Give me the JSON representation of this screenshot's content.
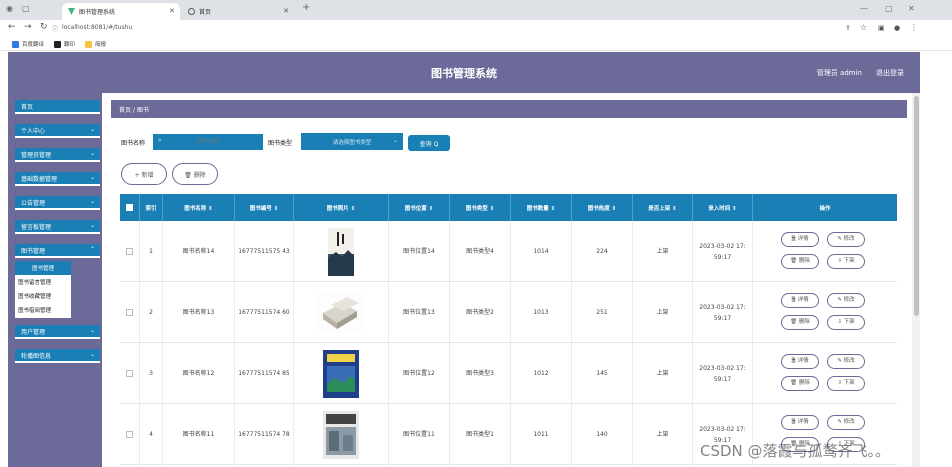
{
  "browser": {
    "tabs": [
      {
        "label": "图书管理系统",
        "active": true
      },
      {
        "label": "首页",
        "active": false
      }
    ],
    "new_tab": "+",
    "url": "localhost:8081/#/tushu",
    "bookmarks": [
      "百度翻译",
      "翻印",
      "简报"
    ],
    "win_min": "—",
    "win_max": "▢",
    "win_close": "✕"
  },
  "header": {
    "title": "图书管理系统",
    "user": "管理员 admin",
    "logout": "退出登录"
  },
  "sidebar": {
    "items": [
      {
        "label": "首页",
        "chevron": ""
      },
      {
        "label": "个人中心",
        "chevron": "⌄"
      },
      {
        "label": "管理员管理",
        "chevron": "⌄"
      },
      {
        "label": "基础数据管理",
        "chevron": "⌄"
      },
      {
        "label": "公告管理",
        "chevron": "⌄"
      },
      {
        "label": "留言板管理",
        "chevron": "⌄"
      },
      {
        "label": "图书管理",
        "chevron": "⌃"
      },
      {
        "label": "用户管理",
        "chevron": "⌄"
      },
      {
        "label": "轮播图信息",
        "chevron": "⌄"
      }
    ],
    "submenu": [
      "图书管理",
      "图书留言管理",
      "图书收藏管理",
      "图书借阅管理"
    ]
  },
  "breadcrumb": "首页 / 图书",
  "filters": {
    "name_label": "图书名称",
    "name_placeholder": "图书名称",
    "type_label": "图书类型",
    "type_placeholder": "请选择图书类型",
    "search_button": "查询 Q"
  },
  "actions": {
    "add": "+ 新增",
    "delete": "🗑 删除"
  },
  "table": {
    "headers": [
      "",
      "索引",
      "图书名称 ⇕",
      "图书编号 ⇕",
      "图书照片 ⇕",
      "图书位置 ⇕",
      "图书类型 ⇕",
      "图书数量 ⇕",
      "图书热度 ⇕",
      "是否上架 ⇕",
      "录入时间 ⇕",
      "操作"
    ],
    "row_buttons": [
      "🗎 详情",
      "✎ 修改",
      "🗑 删除",
      "⇩ 下架"
    ],
    "rows": [
      {
        "index": "1",
        "name": "图书名称14",
        "code": "16777511575 43",
        "location": "图书位置14",
        "type": "图书类型4",
        "count": "1014",
        "heat": "224",
        "shelf": "上架",
        "time": "2023-03-02 17: 59:17",
        "cover": "cover-1"
      },
      {
        "index": "2",
        "name": "图书名称13",
        "code": "16777511574 60",
        "location": "图书位置13",
        "type": "图书类型2",
        "count": "1013",
        "heat": "251",
        "shelf": "上架",
        "time": "2023-03-02 17: 59:17",
        "cover": "cover-2"
      },
      {
        "index": "3",
        "name": "图书名称12",
        "code": "16777511574 85",
        "location": "图书位置12",
        "type": "图书类型3",
        "count": "1012",
        "heat": "145",
        "shelf": "上架",
        "time": "2023-03-02 17: 59:17",
        "cover": "cover-3"
      },
      {
        "index": "4",
        "name": "图书名称11",
        "code": "16777511574 78",
        "location": "图书位置11",
        "type": "图书类型1",
        "count": "1011",
        "heat": "140",
        "shelf": "上架",
        "time": "2023-03-02 17: 59:17",
        "cover": "cover-4"
      }
    ]
  },
  "watermark": "CSDN @落霞与孤鹜齐飞。。",
  "colors": {
    "primary": "#1a7fb5",
    "header": "#6c6a99"
  }
}
